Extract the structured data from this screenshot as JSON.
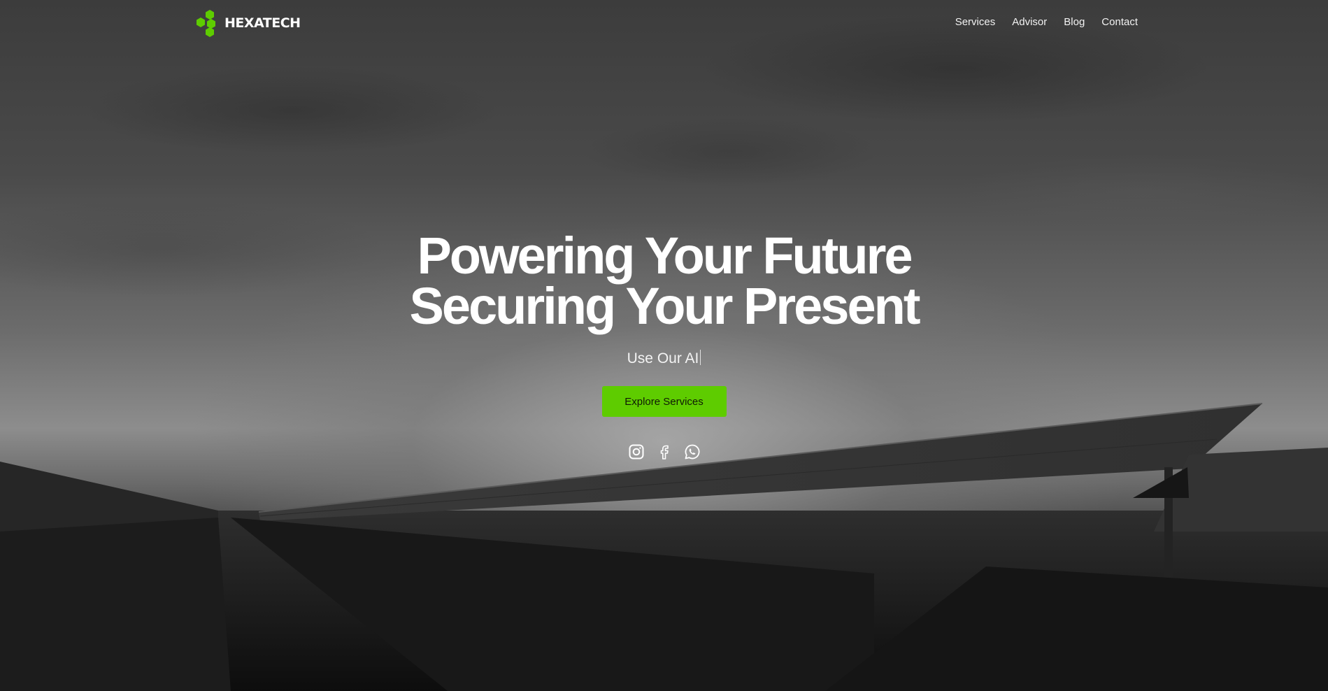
{
  "brand": {
    "name": "HEXATECH",
    "logo_icon": "hexagon-cluster-icon",
    "accent_color": "#5ecc00"
  },
  "nav": {
    "items": [
      {
        "label": "Services"
      },
      {
        "label": "Advisor"
      },
      {
        "label": "Blog"
      },
      {
        "label": "Contact"
      }
    ]
  },
  "hero": {
    "headline_line1": "Powering Your Future",
    "headline_line2": "Securing Your Present",
    "typing_text": "Use Our AI",
    "cta_label": "Explore Services",
    "background": "grayscale photo of solar panel array at dusk"
  },
  "socials": [
    {
      "icon": "instagram-icon"
    },
    {
      "icon": "facebook-icon"
    },
    {
      "icon": "whatsapp-icon"
    }
  ]
}
